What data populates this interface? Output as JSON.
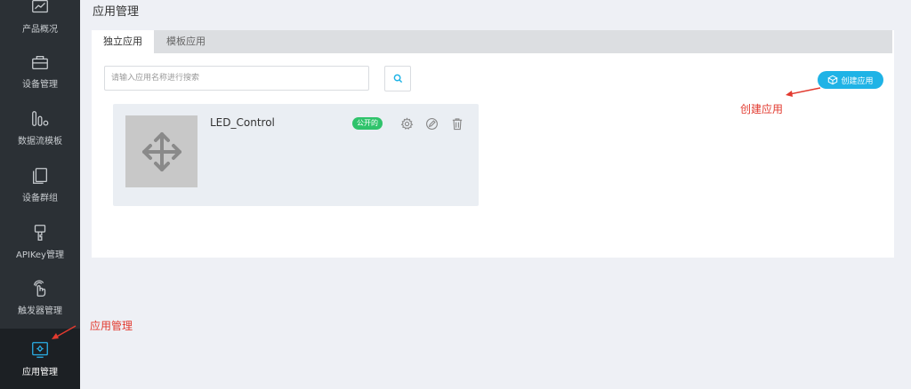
{
  "sidebar": {
    "items": [
      {
        "label": "产品概况",
        "icon": "chart-icon"
      },
      {
        "label": "设备管理",
        "icon": "device-icon"
      },
      {
        "label": "数据流模板",
        "icon": "datastream-icon"
      },
      {
        "label": "设备群组",
        "icon": "group-icon"
      },
      {
        "label": "APIKey管理",
        "icon": "key-icon"
      },
      {
        "label": "触发器管理",
        "icon": "trigger-icon"
      },
      {
        "label": "应用管理",
        "icon": "app-gear-icon",
        "active": true
      }
    ]
  },
  "page": {
    "title": "应用管理"
  },
  "tabs": [
    {
      "label": "独立应用",
      "active": true
    },
    {
      "label": "模板应用",
      "active": false
    }
  ],
  "search": {
    "placeholder": "请输入应用名称进行搜索",
    "value": ""
  },
  "toolbar": {
    "create_label": "创建应用"
  },
  "apps": [
    {
      "name": "LED_Control",
      "status": "公开的"
    }
  ],
  "annotations": {
    "create_app": "创建应用",
    "app_management": "应用管理"
  },
  "colors": {
    "accent": "#1fb3e6",
    "badge": "#2fc36b",
    "annotation": "#e23a2f",
    "sidebar": "#2b3035"
  }
}
